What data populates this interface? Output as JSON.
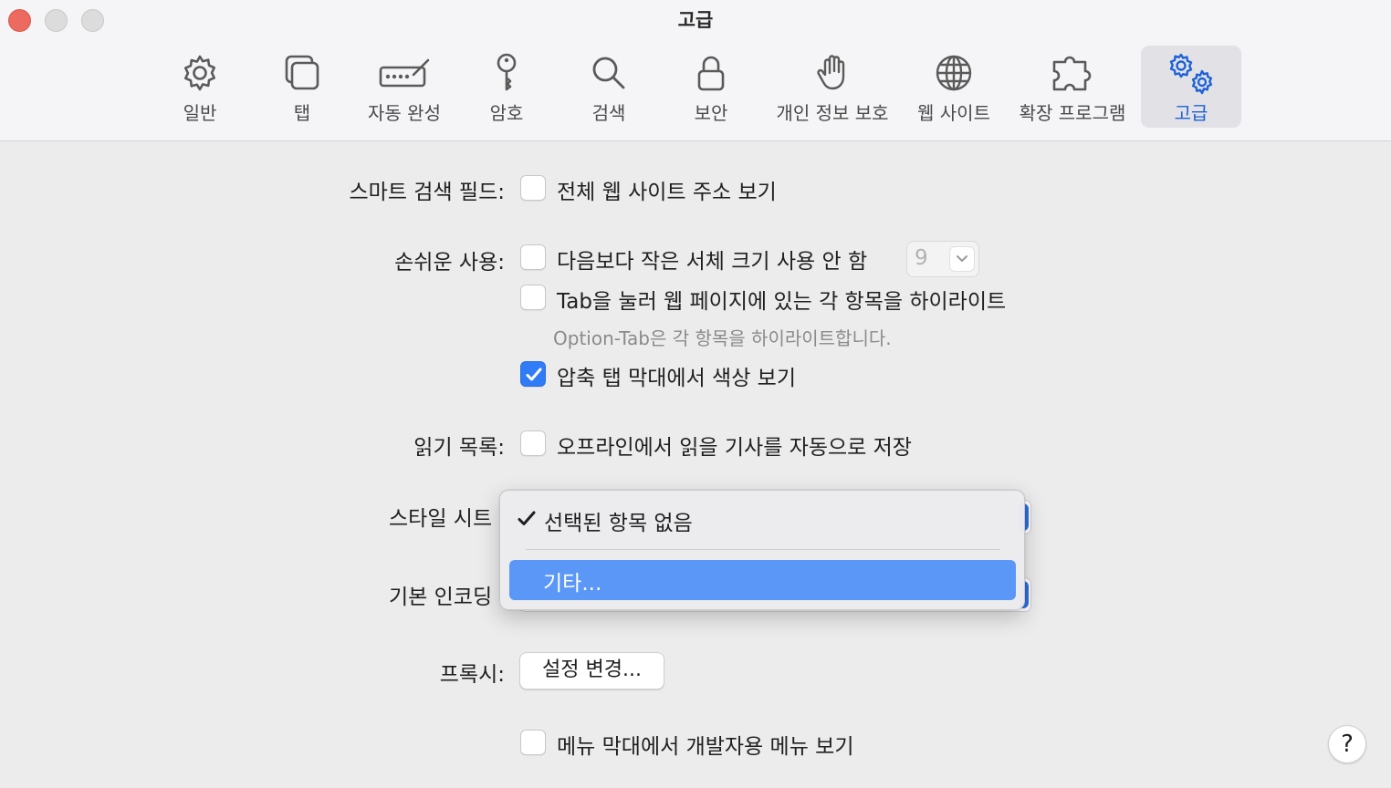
{
  "window": {
    "title": "고급"
  },
  "toolbar": {
    "tabs": [
      {
        "label": "일반",
        "icon": "gear-icon"
      },
      {
        "label": "탭",
        "icon": "tabs-icon"
      },
      {
        "label": "자동 완성",
        "icon": "autofill-icon"
      },
      {
        "label": "암호",
        "icon": "key-icon"
      },
      {
        "label": "검색",
        "icon": "search-icon"
      },
      {
        "label": "보안",
        "icon": "lock-icon"
      },
      {
        "label": "개인 정보 보호",
        "icon": "hand-icon"
      },
      {
        "label": "웹 사이트",
        "icon": "globe-icon"
      },
      {
        "label": "확장 프로그램",
        "icon": "puzzle-icon"
      },
      {
        "label": "고급",
        "icon": "gears-icon",
        "selected": true
      }
    ]
  },
  "smart_search": {
    "label": "스마트 검색 필드:",
    "option": "전체 웹 사이트 주소 보기",
    "checked": false
  },
  "accessibility": {
    "label": "손쉬운 사용:",
    "min_font_option": "다음보다 작은 서체 크기 사용 안 함",
    "min_font_checked": false,
    "min_font_value": "9",
    "tab_highlight_option": "Tab을 눌러 웹 페이지에 있는 각 항목을 하이라이트",
    "tab_highlight_checked": false,
    "tab_highlight_hint": "Option-Tab은 각 항목을 하이라이트합니다.",
    "compact_color_option": "압축 탭 막대에서 색상 보기",
    "compact_color_checked": true
  },
  "reading_list": {
    "label": "읽기 목록:",
    "option": "오프라인에서 읽을 기사를 자동으로 저장",
    "checked": false
  },
  "style_sheet": {
    "label": "스타일 시트"
  },
  "encoding": {
    "label": "기본 인코딩"
  },
  "menu": {
    "items": [
      {
        "label": "선택된 항목 없음",
        "checked": true
      },
      {
        "label": "기타...",
        "highlighted": true
      }
    ]
  },
  "proxy": {
    "label": "프록시:",
    "button": "설정 변경..."
  },
  "developer": {
    "option": "메뉴 막대에서 개발자용 메뉴 보기",
    "checked": false
  },
  "help": {
    "label": "?"
  },
  "colors": {
    "accent": "#2f7cf6",
    "menu_highlight": "#5b97f7",
    "selected_tab_text": "#1d62d8",
    "close_button": "#ec6a5f"
  }
}
